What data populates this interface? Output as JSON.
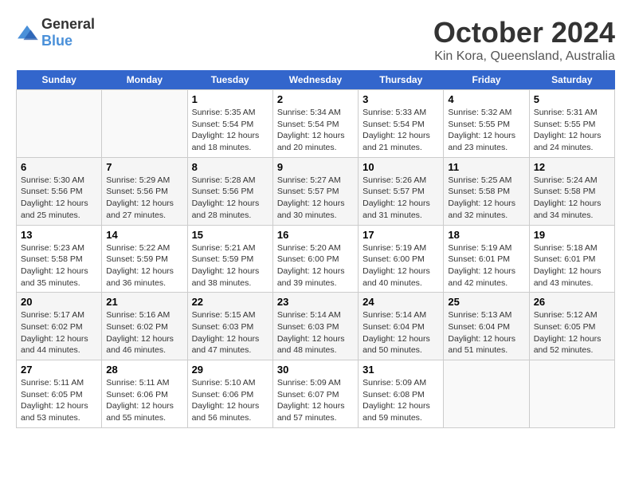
{
  "logo": {
    "general": "General",
    "blue": "Blue"
  },
  "header": {
    "title": "October 2024",
    "subtitle": "Kin Kora, Queensland, Australia"
  },
  "days_of_week": [
    "Sunday",
    "Monday",
    "Tuesday",
    "Wednesday",
    "Thursday",
    "Friday",
    "Saturday"
  ],
  "weeks": [
    [
      {
        "day": "",
        "empty": true
      },
      {
        "day": "",
        "empty": true
      },
      {
        "day": "1",
        "sunrise": "Sunrise: 5:35 AM",
        "sunset": "Sunset: 5:54 PM",
        "daylight": "Daylight: 12 hours and 18 minutes."
      },
      {
        "day": "2",
        "sunrise": "Sunrise: 5:34 AM",
        "sunset": "Sunset: 5:54 PM",
        "daylight": "Daylight: 12 hours and 20 minutes."
      },
      {
        "day": "3",
        "sunrise": "Sunrise: 5:33 AM",
        "sunset": "Sunset: 5:54 PM",
        "daylight": "Daylight: 12 hours and 21 minutes."
      },
      {
        "day": "4",
        "sunrise": "Sunrise: 5:32 AM",
        "sunset": "Sunset: 5:55 PM",
        "daylight": "Daylight: 12 hours and 23 minutes."
      },
      {
        "day": "5",
        "sunrise": "Sunrise: 5:31 AM",
        "sunset": "Sunset: 5:55 PM",
        "daylight": "Daylight: 12 hours and 24 minutes."
      }
    ],
    [
      {
        "day": "6",
        "sunrise": "Sunrise: 5:30 AM",
        "sunset": "Sunset: 5:56 PM",
        "daylight": "Daylight: 12 hours and 25 minutes."
      },
      {
        "day": "7",
        "sunrise": "Sunrise: 5:29 AM",
        "sunset": "Sunset: 5:56 PM",
        "daylight": "Daylight: 12 hours and 27 minutes."
      },
      {
        "day": "8",
        "sunrise": "Sunrise: 5:28 AM",
        "sunset": "Sunset: 5:56 PM",
        "daylight": "Daylight: 12 hours and 28 minutes."
      },
      {
        "day": "9",
        "sunrise": "Sunrise: 5:27 AM",
        "sunset": "Sunset: 5:57 PM",
        "daylight": "Daylight: 12 hours and 30 minutes."
      },
      {
        "day": "10",
        "sunrise": "Sunrise: 5:26 AM",
        "sunset": "Sunset: 5:57 PM",
        "daylight": "Daylight: 12 hours and 31 minutes."
      },
      {
        "day": "11",
        "sunrise": "Sunrise: 5:25 AM",
        "sunset": "Sunset: 5:58 PM",
        "daylight": "Daylight: 12 hours and 32 minutes."
      },
      {
        "day": "12",
        "sunrise": "Sunrise: 5:24 AM",
        "sunset": "Sunset: 5:58 PM",
        "daylight": "Daylight: 12 hours and 34 minutes."
      }
    ],
    [
      {
        "day": "13",
        "sunrise": "Sunrise: 5:23 AM",
        "sunset": "Sunset: 5:58 PM",
        "daylight": "Daylight: 12 hours and 35 minutes."
      },
      {
        "day": "14",
        "sunrise": "Sunrise: 5:22 AM",
        "sunset": "Sunset: 5:59 PM",
        "daylight": "Daylight: 12 hours and 36 minutes."
      },
      {
        "day": "15",
        "sunrise": "Sunrise: 5:21 AM",
        "sunset": "Sunset: 5:59 PM",
        "daylight": "Daylight: 12 hours and 38 minutes."
      },
      {
        "day": "16",
        "sunrise": "Sunrise: 5:20 AM",
        "sunset": "Sunset: 6:00 PM",
        "daylight": "Daylight: 12 hours and 39 minutes."
      },
      {
        "day": "17",
        "sunrise": "Sunrise: 5:19 AM",
        "sunset": "Sunset: 6:00 PM",
        "daylight": "Daylight: 12 hours and 40 minutes."
      },
      {
        "day": "18",
        "sunrise": "Sunrise: 5:19 AM",
        "sunset": "Sunset: 6:01 PM",
        "daylight": "Daylight: 12 hours and 42 minutes."
      },
      {
        "day": "19",
        "sunrise": "Sunrise: 5:18 AM",
        "sunset": "Sunset: 6:01 PM",
        "daylight": "Daylight: 12 hours and 43 minutes."
      }
    ],
    [
      {
        "day": "20",
        "sunrise": "Sunrise: 5:17 AM",
        "sunset": "Sunset: 6:02 PM",
        "daylight": "Daylight: 12 hours and 44 minutes."
      },
      {
        "day": "21",
        "sunrise": "Sunrise: 5:16 AM",
        "sunset": "Sunset: 6:02 PM",
        "daylight": "Daylight: 12 hours and 46 minutes."
      },
      {
        "day": "22",
        "sunrise": "Sunrise: 5:15 AM",
        "sunset": "Sunset: 6:03 PM",
        "daylight": "Daylight: 12 hours and 47 minutes."
      },
      {
        "day": "23",
        "sunrise": "Sunrise: 5:14 AM",
        "sunset": "Sunset: 6:03 PM",
        "daylight": "Daylight: 12 hours and 48 minutes."
      },
      {
        "day": "24",
        "sunrise": "Sunrise: 5:14 AM",
        "sunset": "Sunset: 6:04 PM",
        "daylight": "Daylight: 12 hours and 50 minutes."
      },
      {
        "day": "25",
        "sunrise": "Sunrise: 5:13 AM",
        "sunset": "Sunset: 6:04 PM",
        "daylight": "Daylight: 12 hours and 51 minutes."
      },
      {
        "day": "26",
        "sunrise": "Sunrise: 5:12 AM",
        "sunset": "Sunset: 6:05 PM",
        "daylight": "Daylight: 12 hours and 52 minutes."
      }
    ],
    [
      {
        "day": "27",
        "sunrise": "Sunrise: 5:11 AM",
        "sunset": "Sunset: 6:05 PM",
        "daylight": "Daylight: 12 hours and 53 minutes."
      },
      {
        "day": "28",
        "sunrise": "Sunrise: 5:11 AM",
        "sunset": "Sunset: 6:06 PM",
        "daylight": "Daylight: 12 hours and 55 minutes."
      },
      {
        "day": "29",
        "sunrise": "Sunrise: 5:10 AM",
        "sunset": "Sunset: 6:06 PM",
        "daylight": "Daylight: 12 hours and 56 minutes."
      },
      {
        "day": "30",
        "sunrise": "Sunrise: 5:09 AM",
        "sunset": "Sunset: 6:07 PM",
        "daylight": "Daylight: 12 hours and 57 minutes."
      },
      {
        "day": "31",
        "sunrise": "Sunrise: 5:09 AM",
        "sunset": "Sunset: 6:08 PM",
        "daylight": "Daylight: 12 hours and 59 minutes."
      },
      {
        "day": "",
        "empty": true
      },
      {
        "day": "",
        "empty": true
      }
    ]
  ]
}
